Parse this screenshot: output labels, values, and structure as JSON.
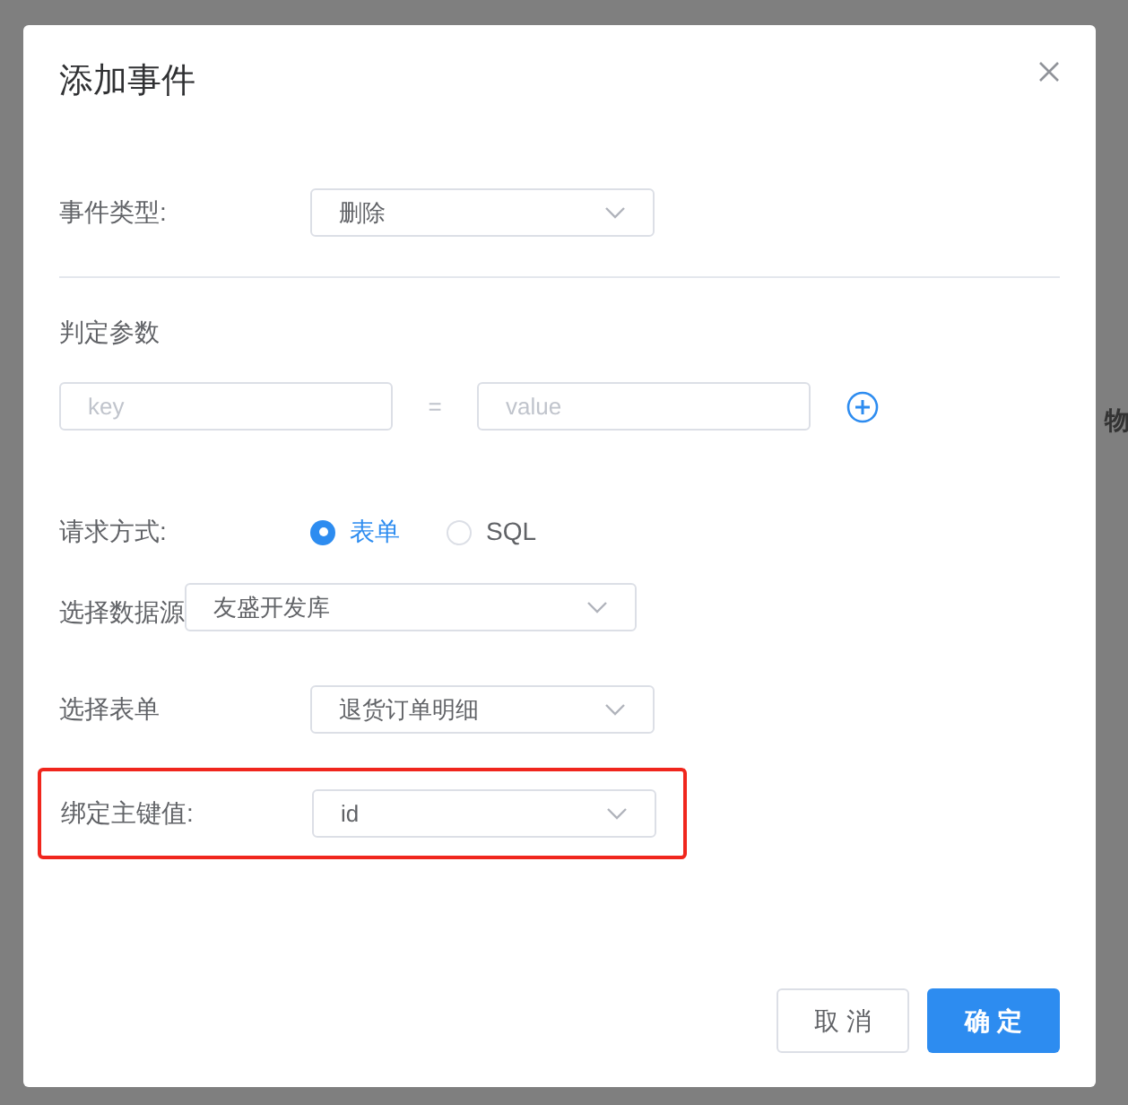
{
  "background": {
    "edge_text": "物"
  },
  "dialog": {
    "title": "添加事件",
    "event_type": {
      "label": "事件类型:",
      "value": "删除"
    },
    "params": {
      "label": "判定参数",
      "key_placeholder": "key",
      "equals": "=",
      "value_placeholder": "value"
    },
    "request_method": {
      "label": "请求方式:",
      "options": [
        {
          "label": "表单",
          "selected": true
        },
        {
          "label": "SQL",
          "selected": false
        }
      ]
    },
    "data_source": {
      "label": "选择数据源",
      "value": "友盛开发库"
    },
    "form": {
      "label": "选择表单",
      "value": "退货订单明细"
    },
    "primary_key": {
      "label": "绑定主键值:",
      "value": "id",
      "highlighted": true
    },
    "buttons": [
      {
        "label": "取 消",
        "kind": "secondary"
      },
      {
        "label": "确 定",
        "kind": "primary"
      }
    ]
  }
}
